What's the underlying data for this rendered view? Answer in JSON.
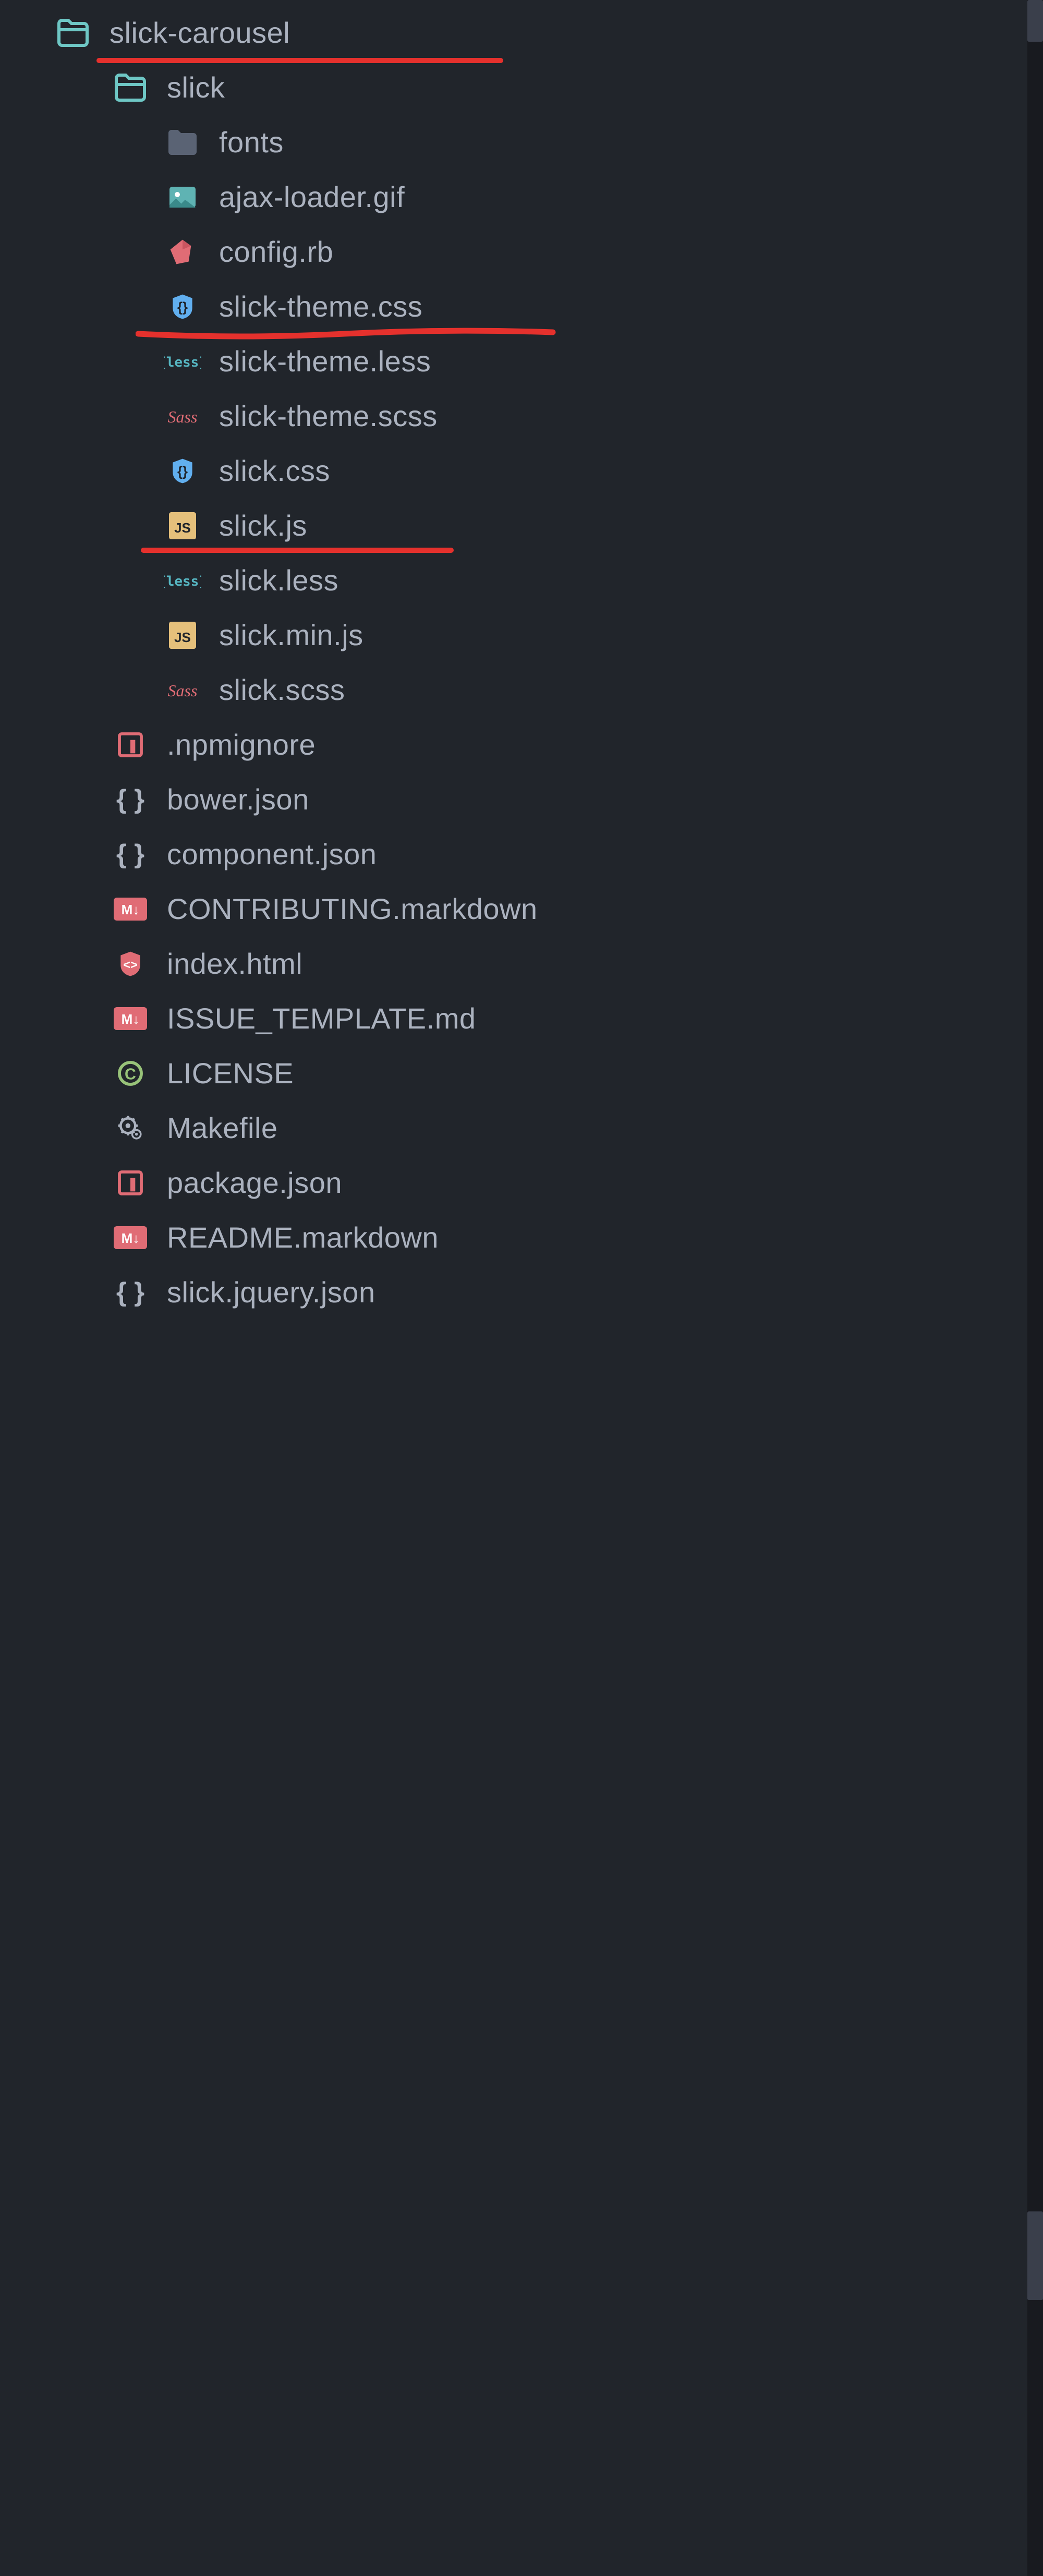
{
  "tree": {
    "root": {
      "label": "slick-carousel",
      "type": "folder-open",
      "underlined": true
    },
    "children": [
      {
        "label": "slick",
        "type": "folder-open",
        "indent": 1,
        "children": [
          {
            "label": "fonts",
            "type": "folder-closed",
            "indent": 2
          },
          {
            "label": "ajax-loader.gif",
            "type": "image",
            "indent": 2
          },
          {
            "label": "config.rb",
            "type": "ruby",
            "indent": 2
          },
          {
            "label": "slick-theme.css",
            "type": "css",
            "indent": 2,
            "underlined": true
          },
          {
            "label": "slick-theme.less",
            "type": "less",
            "indent": 2
          },
          {
            "label": "slick-theme.scss",
            "type": "scss",
            "indent": 2
          },
          {
            "label": "slick.css",
            "type": "css",
            "indent": 2,
            "underlined": true
          },
          {
            "label": "slick.js",
            "type": "js",
            "indent": 2
          },
          {
            "label": "slick.less",
            "type": "less",
            "indent": 2
          },
          {
            "label": "slick.min.js",
            "type": "js",
            "indent": 2
          },
          {
            "label": "slick.scss",
            "type": "scss",
            "indent": 2
          }
        ]
      },
      {
        "label": ".npmignore",
        "type": "npm",
        "indent": 1
      },
      {
        "label": "bower.json",
        "type": "json",
        "indent": 1
      },
      {
        "label": "component.json",
        "type": "json",
        "indent": 1
      },
      {
        "label": "CONTRIBUTING.markdown",
        "type": "markdown",
        "indent": 1
      },
      {
        "label": "index.html",
        "type": "html",
        "indent": 1
      },
      {
        "label": "ISSUE_TEMPLATE.md",
        "type": "markdown",
        "indent": 1
      },
      {
        "label": "LICENSE",
        "type": "license",
        "indent": 1
      },
      {
        "label": "Makefile",
        "type": "makefile",
        "indent": 1
      },
      {
        "label": "package.json",
        "type": "npm",
        "indent": 1
      },
      {
        "label": "README.markdown",
        "type": "markdown",
        "indent": 1
      },
      {
        "label": "slick.jquery.json",
        "type": "json",
        "indent": 1
      }
    ]
  },
  "colors": {
    "folder_open_stroke": "#6ec7c5",
    "folder_closed_fill": "#5a6374",
    "image_bg": "#5fb3b3",
    "ruby": "#e06c75",
    "css_bg": "#61afef",
    "less": "#56b6c2",
    "scss": "#e06c75",
    "js_bg": "#e5c07b",
    "npm_border": "#e06c75",
    "json": "#abb2bf",
    "markdown_bg": "#e06c75",
    "html_bg": "#e06c75",
    "license": "#98c379",
    "makefile": "#abb2bf",
    "underline": "#e5312d"
  }
}
